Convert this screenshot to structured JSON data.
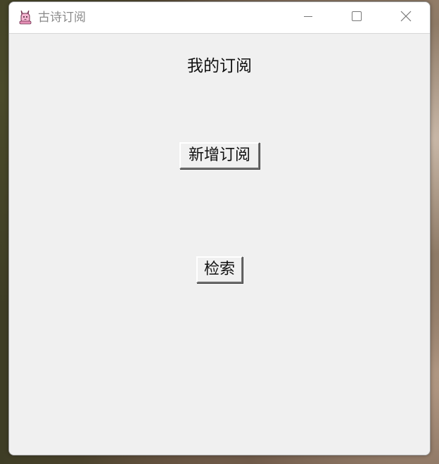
{
  "window": {
    "title": "古诗订阅",
    "icon": "pink-creature-app-icon"
  },
  "caption_buttons": {
    "minimize_icon": "minimize-icon",
    "maximize_icon": "maximize-icon",
    "close_icon": "close-icon"
  },
  "main": {
    "heading": "我的订阅",
    "add_button_label": "新增订阅",
    "search_button_label": "检索"
  }
}
